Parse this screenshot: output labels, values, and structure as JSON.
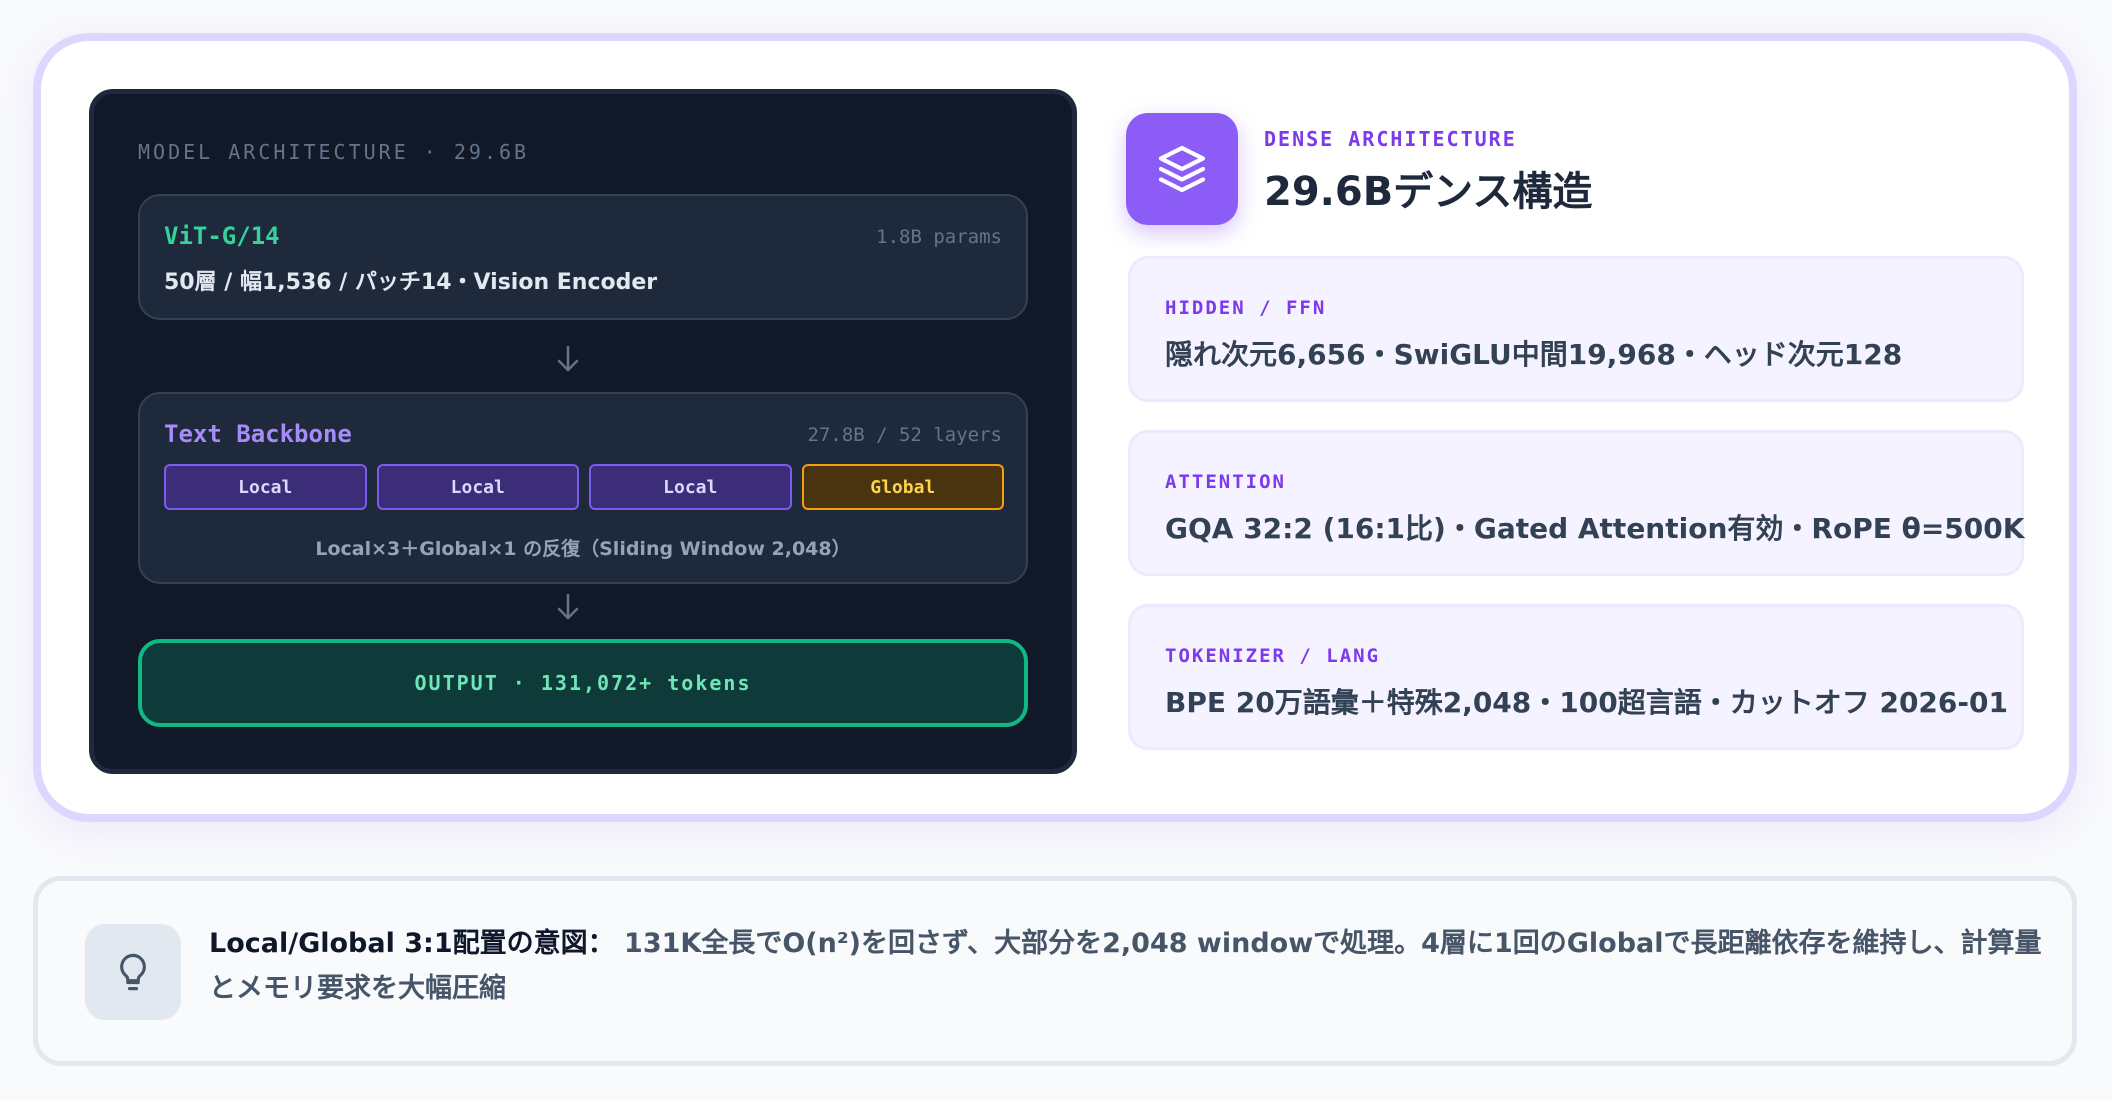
{
  "architecture": {
    "title": "MODEL ARCHITECTURE · 29.6B",
    "vision": {
      "name": "ViT-G/14",
      "params": "1.8B params",
      "desc": "50層 / 幅1,536 / パッチ14・Vision Encoder"
    },
    "backbone": {
      "name": "Text Backbone",
      "meta": "27.8B / 52 layers",
      "layers": [
        "Local",
        "Local",
        "Local",
        "Global"
      ],
      "caption": "Local×3＋Global×1 の反復（Sliding Window 2,048）"
    },
    "output": "OUTPUT · 131,072+ tokens"
  },
  "header": {
    "icon": "layers-icon",
    "eyebrow": "DENSE ARCHITECTURE",
    "title": "29.6Bデンス構造"
  },
  "specs": [
    {
      "label": "HIDDEN / FFN",
      "value": "隠れ次元6,656・SwiGLU中間19,968・ヘッド次元128"
    },
    {
      "label": "ATTENTION",
      "value": "GQA 32:2 (16:1比)・Gated Attention有効・RoPE θ=500K"
    },
    {
      "label": "TOKENIZER / LANG",
      "value": "BPE 20万語彙＋特殊2,048・100超言語・カットオフ 2026-01"
    }
  ],
  "note": {
    "icon": "lightbulb-icon",
    "lead": "Local/Global 3:1配置の意図：",
    "text": " 131K全長でO(n²)を回さず、大部分を2,048 windowで処理。4層に1回のGlobalで長距離依存を維持し、計算量とメモリ要求を大幅圧縮"
  },
  "colors": {
    "accent": "#8b5cf6",
    "vision": "#34d399",
    "local": "#7c5cf0",
    "global": "#f59e0b",
    "output": "#10b981"
  }
}
